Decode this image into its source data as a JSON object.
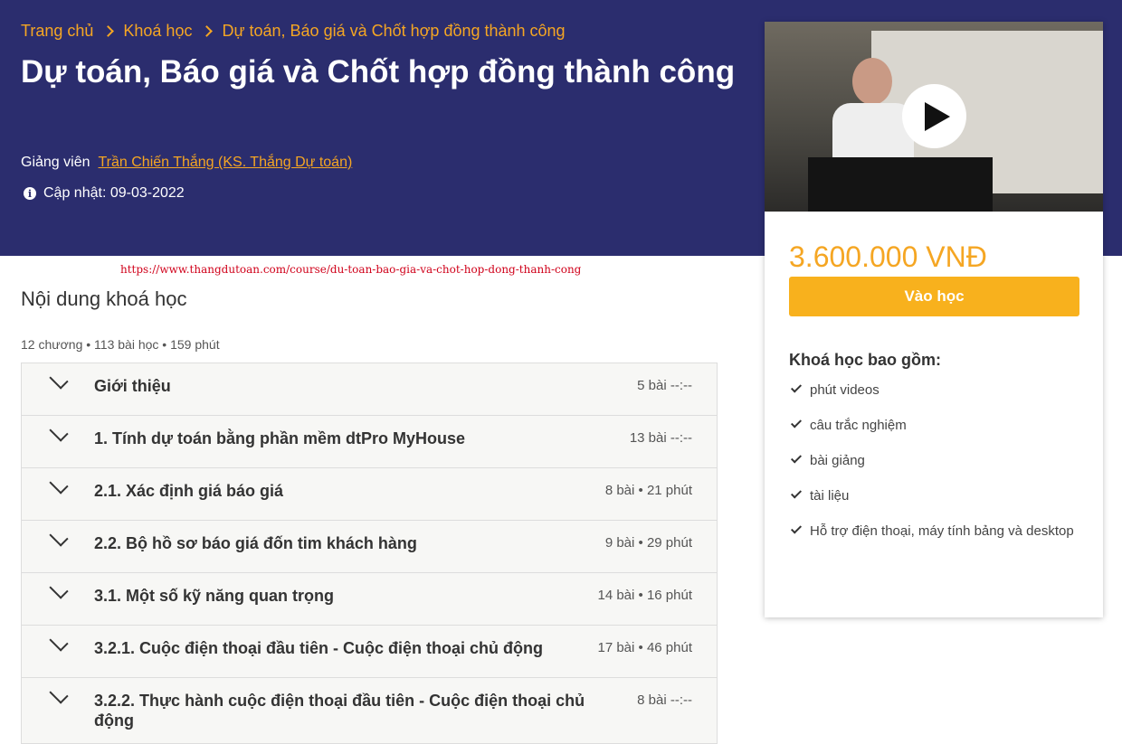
{
  "breadcrumb": {
    "home": "Trang chủ",
    "courses": "Khoá học",
    "current": "Dự toán, Báo giá và Chốt hợp đồng thành công"
  },
  "course": {
    "title": "Dự toán, Báo giá và Chốt hợp đồng thành công",
    "instructor_label": "Giảng viên",
    "instructor_name": "Trần Chiến Thắng (KS. Thắng Dự toán)",
    "updated": "Cập nhật: 09-03-2022"
  },
  "url_overlay": "https://www.thangdutoan.com/course/du-toan-bao-gia-va-chot-hop-dong-thanh-cong",
  "curriculum": {
    "heading": "Nội dung khoá học",
    "summary": "12 chương • 113 bài học • 159 phút",
    "chapters": [
      {
        "title": "Giới thiệu",
        "meta": "5 bài  --:--"
      },
      {
        "title": "1. Tính dự toán bằng phần mềm dtPro MyHouse",
        "meta": "13 bài  --:--"
      },
      {
        "title": "2.1. Xác định giá báo giá",
        "meta": "8 bài • 21 phút"
      },
      {
        "title": "2.2. Bộ hồ sơ báo giá đốn tim khách hàng",
        "meta": "9 bài • 29 phút"
      },
      {
        "title": "3.1. Một số kỹ năng quan trọng",
        "meta": "14 bài • 16 phút"
      },
      {
        "title": "3.2.1. Cuộc điện thoại đầu tiên - Cuộc điện thoại chủ động",
        "meta": "17 bài • 46 phút"
      },
      {
        "title": "3.2.2. Thực hành cuộc điện thoại đầu tiên - Cuộc điện thoại chủ động",
        "meta": "8 bài  --:--"
      }
    ]
  },
  "sidebar": {
    "price": "3.600.000 VNĐ",
    "enroll_label": "Vào học",
    "includes_title": "Khoá học bao gồm:",
    "includes": [
      "phút videos",
      "câu trắc nghiệm",
      "bài giảng",
      "tài liệu",
      "Hỗ trợ điện thoại, máy tính bảng và desktop"
    ],
    "video_icon": "play-icon"
  },
  "colors": {
    "hero_bg": "#2b2d6e",
    "accent": "#f5a623",
    "button": "#f8b11d",
    "url_overlay": "#d0021b"
  }
}
